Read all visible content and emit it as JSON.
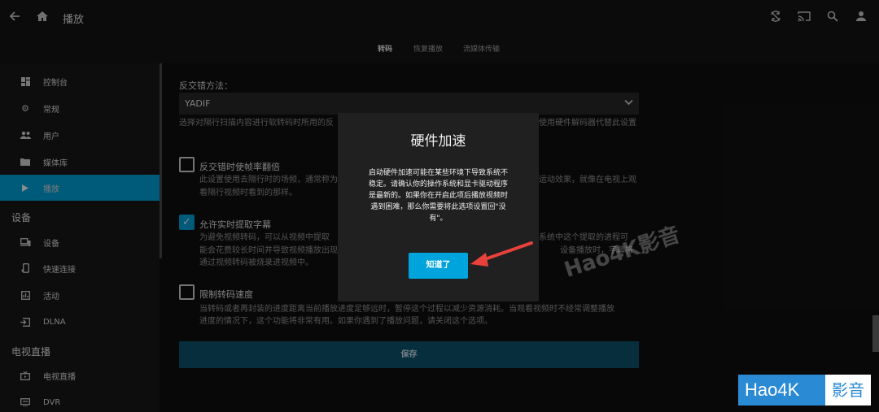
{
  "header": {
    "title": "播放",
    "tabs": [
      {
        "label": "转码",
        "active": true
      },
      {
        "label": "恢复播放",
        "active": false
      },
      {
        "label": "流媒体传输",
        "active": false
      }
    ],
    "icons": [
      "back-arrow-icon",
      "home-icon",
      "sync-icon",
      "cast-icon",
      "search-icon",
      "user-icon"
    ]
  },
  "sidebar": {
    "items": [
      {
        "label": "控制台",
        "icon": "dashboard-icon"
      },
      {
        "label": "常规",
        "icon": "gear-icon"
      },
      {
        "label": "用户",
        "icon": "people-icon"
      },
      {
        "label": "媒体库",
        "icon": "folder-icon"
      },
      {
        "label": "播放",
        "icon": "play-icon",
        "active": true
      }
    ],
    "section_devices": "设备",
    "device_items": [
      {
        "label": "设备",
        "icon": "devices-icon"
      },
      {
        "label": "快速连接",
        "icon": "phone-link-icon"
      },
      {
        "label": "活动",
        "icon": "activity-icon"
      },
      {
        "label": "DLNA",
        "icon": "input-icon"
      }
    ],
    "section_livetv": "电视直播",
    "livetv_items": [
      {
        "label": "电视直播",
        "icon": "live-tv-icon"
      },
      {
        "label": "DVR",
        "icon": "dvr-icon"
      }
    ]
  },
  "form": {
    "deinterlace_label": "反交错方法：",
    "deinterlace_value": "YADIF",
    "deinterlace_help_left": "选择对隔行扫描内容进行软转码时所用的反",
    "deinterlace_help_right": "使用硬件解码器代替此设置",
    "double_rate_label": "反交错时使帧率翻倍",
    "double_rate_help_1a": "此设置使用去隔行时的场频，通常称为",
    "double_rate_help_1b": "运动效果，就像在电视上观",
    "double_rate_help_2": "看隔行视频时看到的那样。",
    "subtitle_label": "允许实时提取字幕",
    "subtitle_help_1a": "为避免视频转码，可以从视频中提取",
    "subtitle_help_1b": "系统中这个提取的进程可",
    "subtitle_help_2a": "能会花费较长时间并导致视频播放出现",
    "subtitle_help_2b": "设备播放时，字幕将",
    "subtitle_help_3": "通过视频转码被烧录进视频中。",
    "throttle_label": "限制转码速度",
    "throttle_help_1": "当转码或者再封装的进度距离当前播放进度足够远时，暂停这个过程以减少资源消耗。当观看视频时不经常调整播放",
    "throttle_help_2": "进度的情况下，这个功能将非常有用。如果你遇到了播放问题，请关闭这个选项。",
    "save_label": "保存"
  },
  "dialog": {
    "title": "硬件加速",
    "line1": "启动硬件加速可能在某些环境下导致系统不",
    "line2": "稳定。请确认你的操作系统和显卡驱动程序",
    "line3": "是最新的。如果你在开启此项后播放视频时",
    "line4": "遇到困难，那么你需要将此选项设置回\"没",
    "line5": "有\"。",
    "ok_label": "知道了"
  },
  "watermark": {
    "diagonal": "Hao4K影音",
    "brand_left": "Hao4K",
    "brand_right": "影音"
  },
  "colors": {
    "accent": "#00A4DC",
    "arrow": "#e8413c"
  }
}
